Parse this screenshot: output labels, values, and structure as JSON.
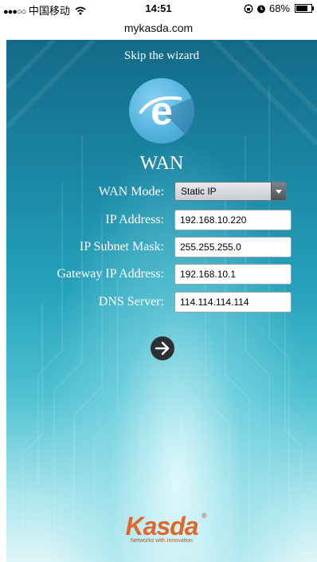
{
  "status_bar": {
    "signal": "●●●○○",
    "carrier": "中国移动",
    "wifi_icon": "wifi-icon",
    "time": "14:51",
    "lock_icon": "rotation-lock-icon",
    "alarm_icon": "alarm-icon",
    "battery_percent": "68%",
    "battery_level": 0.68
  },
  "browser": {
    "url": "mykasda.com"
  },
  "wizard": {
    "skip_label": "Skip the wizard",
    "logo_icon": "internet-explorer-e-icon",
    "title": "WAN",
    "wan_mode": {
      "label": "WAN Mode:",
      "value": "Static IP"
    },
    "ip_address": {
      "label": "IP Address:",
      "value": "192.168.10.220"
    },
    "subnet_mask": {
      "label": "IP Subnet Mask:",
      "value": "255.255.255.0"
    },
    "gateway": {
      "label": "Gateway IP Address:",
      "value": "192.168.10.1"
    },
    "dns": {
      "label": "DNS Server:",
      "value": "114.114.114.114"
    },
    "next_icon": "arrow-right-icon"
  },
  "brand": {
    "name": "Kasda",
    "registered": "®",
    "tagline": "Networks with Innovation"
  },
  "colors": {
    "background_top": "#136a88",
    "background_bottom": "#dff6f8",
    "brand_orange": "#e0662a"
  }
}
